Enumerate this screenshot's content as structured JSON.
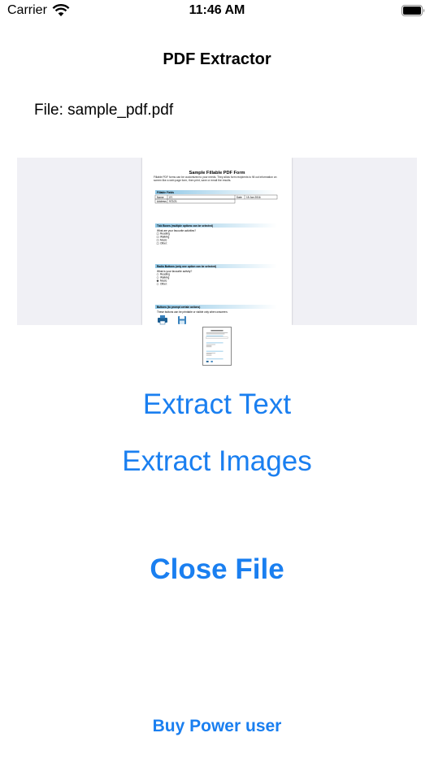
{
  "status_bar": {
    "carrier": "Carrier",
    "time": "11:46 AM"
  },
  "nav": {
    "title": "PDF Extractor"
  },
  "file": {
    "label": "File: sample_pdf.pdf"
  },
  "pdf_page": {
    "title": "Sample Fillable PDF Form",
    "intro": "Fillable PDF forms can be customized to your needs. They allow form recipients to fill out information on screen like a web page form, then print, save or email the results.",
    "fields_header": "Fillable Fields",
    "name_label": "Name",
    "name_value": "XY",
    "date_label": "Date",
    "date_value": "15  Jan  2016",
    "address_label": "Address",
    "address_value": "972/21",
    "tick_header": "Tick Boxes (multiple options can be selected)",
    "tick_question": "What are your favourite activities?",
    "tick_options": [
      "Reading",
      "Walking",
      "Music",
      "Other:"
    ],
    "radio_header": "Radio Buttons (only one option can be selected)",
    "radio_question": "What is your favourite activity?",
    "radio_options": [
      "Reading",
      "Walking",
      "Music",
      "Other:"
    ],
    "buttons_header": "Buttons (to prompt certain actions)",
    "buttons_note": "These buttons can be printable or visible only when onscreen."
  },
  "actions": {
    "extract_text": "Extract Text",
    "extract_images": "Extract Images",
    "close_file": "Close File",
    "buy_power_user": "Buy Power user"
  },
  "colors": {
    "accent": "#1a7ff0",
    "preview_bg": "#f0f0f5",
    "section_bar": "#a8d4ec"
  }
}
